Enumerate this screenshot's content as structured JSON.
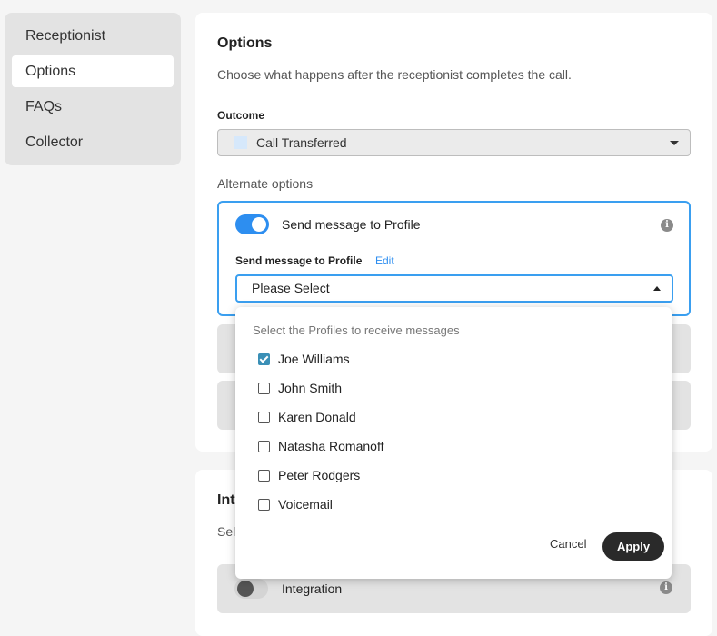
{
  "sidebar": {
    "items": [
      {
        "label": "Receptionist"
      },
      {
        "label": "Options"
      },
      {
        "label": "FAQs"
      },
      {
        "label": "Collector"
      }
    ]
  },
  "options_panel": {
    "title": "Options",
    "description": "Choose what happens after the receptionist completes the call.",
    "outcome_label": "Outcome",
    "outcome_value": "Call Transferred",
    "alternate_label": "Alternate options",
    "card": {
      "title": "Send message to Profile",
      "toggle_on": true,
      "sub_label": "Send message to Profile",
      "edit_label": "Edit",
      "select_value": "Please Select"
    }
  },
  "integration_panel": {
    "title": "Int",
    "description": "Sel",
    "row_label": "Integration",
    "toggle_on": false
  },
  "dropdown": {
    "header": "Select the Profiles to receive messages",
    "options": [
      {
        "label": "Joe Williams",
        "checked": true
      },
      {
        "label": "John Smith",
        "checked": false
      },
      {
        "label": "Karen Donald",
        "checked": false
      },
      {
        "label": "Natasha Romanoff",
        "checked": false
      },
      {
        "label": "Peter Rodgers",
        "checked": false
      },
      {
        "label": "Voicemail",
        "checked": false
      }
    ],
    "cancel_label": "Cancel",
    "apply_label": "Apply"
  },
  "colors": {
    "accent": "#2d8ef0",
    "checkbox_checked": "#3a8fb6",
    "apply_button": "#2a2a2a"
  }
}
